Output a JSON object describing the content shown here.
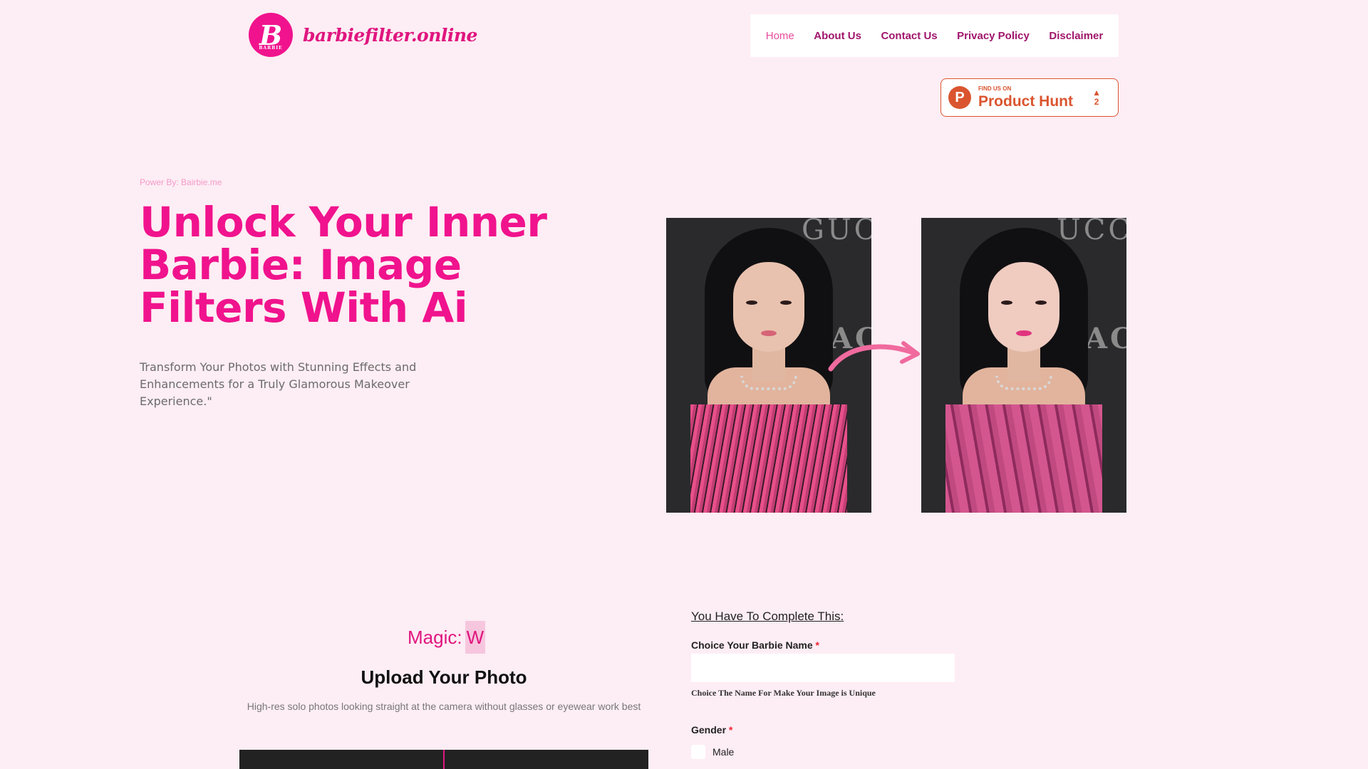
{
  "header": {
    "logo_mark": "B",
    "logo_mark_sub": "BARBIE",
    "brand": "barbiefilter.online",
    "nav": [
      "Home",
      "About Us",
      "Contact Us",
      "Privacy Policy",
      "Disclaimer"
    ],
    "active_nav": "Home"
  },
  "product_hunt": {
    "logo_letter": "P",
    "small_text": "FIND US ON",
    "big_text": "Product Hunt",
    "vote_arrow": "▲",
    "vote_count": "2"
  },
  "hero": {
    "powered_by": "Power By: Bairbie.me",
    "title": "Unlock Your Inner Barbie: Image Filters With Ai",
    "subtitle": "Transform Your Photos with Stunning Effects and Enhancements for a Truly Glamorous Makeover Experience.\""
  },
  "images": {
    "before_bg_top": "GUC",
    "before_bg_mid": "ACM",
    "after_bg_top": "UCC",
    "after_bg_mid": "ACM"
  },
  "upload": {
    "magic_label": "Magic:",
    "magic_highlight": "W",
    "title": "Upload Your Photo",
    "subtitle": "High-res solo photos looking straight at the camera without glasses or eyewear work best"
  },
  "form": {
    "heading": "You Have To Complete This:",
    "name_label": "Choice Your Barbie Name",
    "required_mark": "*",
    "name_value": "",
    "name_help": "Choice The Name For Make Your Image is Unique",
    "gender_label": "Gender",
    "gender_options": [
      "Male"
    ]
  },
  "colors": {
    "background": "#fdedf4",
    "brand_pink": "#f0138d",
    "nav_text": "#a0156b",
    "product_hunt": "#da552f"
  }
}
